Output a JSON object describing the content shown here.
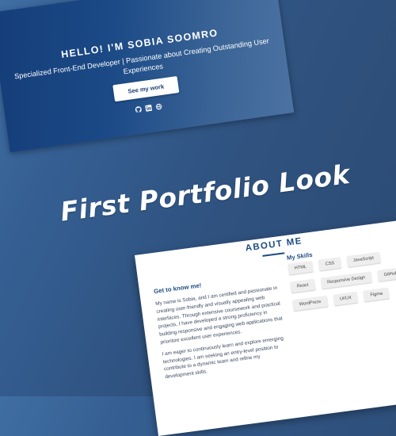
{
  "hero": {
    "title": "HELLO! I'M SOBIA SOOMRO",
    "subtitle": "Specialized Front-End Developer | Passionate about Creating Outstanding User Experiences",
    "button_label": "See my work",
    "social_icons": [
      "github-icon",
      "linkedin-icon",
      "globe-icon"
    ]
  },
  "headline": "First Portfolio Look",
  "about": {
    "title": "ABOUT ME",
    "intro_heading": "Get to know me!",
    "intro_paragraphs": [
      "My name is Sobia, and I am certified and passionate in creating user-friendly and visually appealing web interfaces. Through extensive coursework and practical projects, I have developed a strong proficiency in building responsive and engaging web applications that prioritize excellent user experiences.",
      "I am eager to continuously learn and explore emerging technologies. I am seeking an entry-level position to contribute to a dynamic team and refine my development skills."
    ],
    "skills_heading": "My Skills",
    "skills": [
      "HTML",
      "CSS",
      "JavaScript",
      "React",
      "Responsive Design",
      "GitHub",
      "WordPress",
      "UI/UX",
      "Figma"
    ]
  },
  "colors": {
    "accent": "#1f4b82",
    "hero_bg": "#1b4a86",
    "page_bg": "#2f527f"
  }
}
